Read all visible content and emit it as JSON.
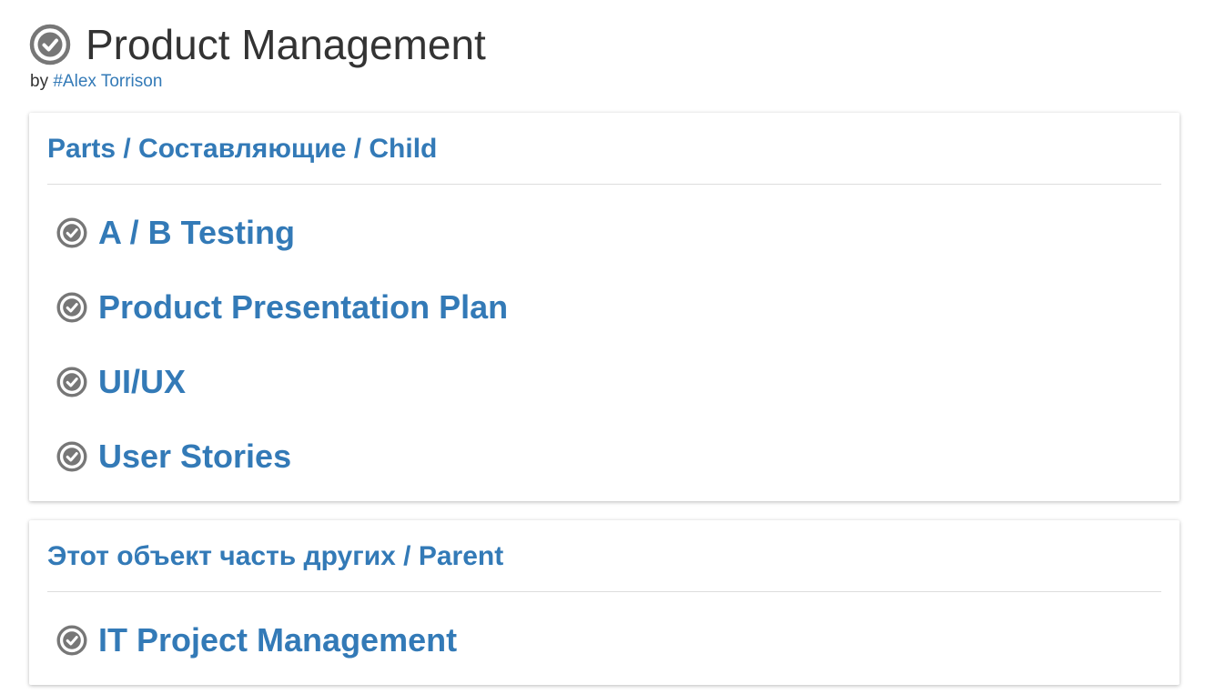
{
  "header": {
    "title": "Product Management",
    "by_prefix": "by",
    "author": "#Alex Torrison"
  },
  "children_panel": {
    "heading": "Parts / Составляющие / Child",
    "items": [
      {
        "label": "A / B Testing",
        "icon": "check-circle-icon"
      },
      {
        "label": "Product Presentation Plan",
        "icon": "check-circle-icon"
      },
      {
        "label": "UI/UX",
        "icon": "check-circle-icon"
      },
      {
        "label": "User Stories",
        "icon": "check-circle-icon"
      }
    ]
  },
  "parent_panel": {
    "heading": "Этот объект часть других / Parent",
    "items": [
      {
        "label": "IT Project Management",
        "icon": "check-circle-icon"
      }
    ]
  },
  "colors": {
    "link": "#337ab7",
    "text": "#333333",
    "icon": "#777777",
    "divider": "#dddddd"
  }
}
